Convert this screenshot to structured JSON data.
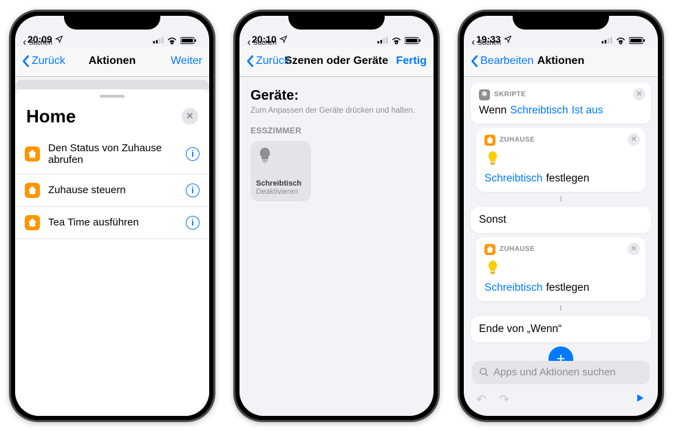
{
  "status": {
    "backapp": "Suchen",
    "time1": "20:09",
    "time2": "20:10",
    "time3": "19:33"
  },
  "phone1": {
    "nav": {
      "back": "Zurück",
      "title": "Aktionen",
      "next": "Weiter"
    },
    "sheet": {
      "title": "Home"
    },
    "rows": [
      {
        "label": "Den Status von Zuhause abrufen"
      },
      {
        "label": "Zuhause steuern"
      },
      {
        "label": "Tea Time ausführen"
      }
    ]
  },
  "phone2": {
    "nav": {
      "back": "Zurück",
      "title": "Szenen oder Geräte",
      "done": "Fertig"
    },
    "heading": "Geräte:",
    "hint": "Zum Anpassen der Geräte drücken und halten.",
    "group": "ESSZIMMER",
    "device": {
      "name": "Schreibtisch",
      "state": "Deaktivieren"
    }
  },
  "phone3": {
    "nav": {
      "back": "Bearbeiten",
      "title": "Aktionen"
    },
    "script": {
      "head": "Skripte",
      "wenn": "Wenn",
      "var": "Schreibtisch",
      "cond": "Ist aus",
      "sonst": "Sonst",
      "ende": "Ende von „Wenn“"
    },
    "home": {
      "head": "Zuhause",
      "device": "Schreibtisch",
      "action": "festlegen"
    },
    "search": "Apps und Aktionen suchen"
  }
}
